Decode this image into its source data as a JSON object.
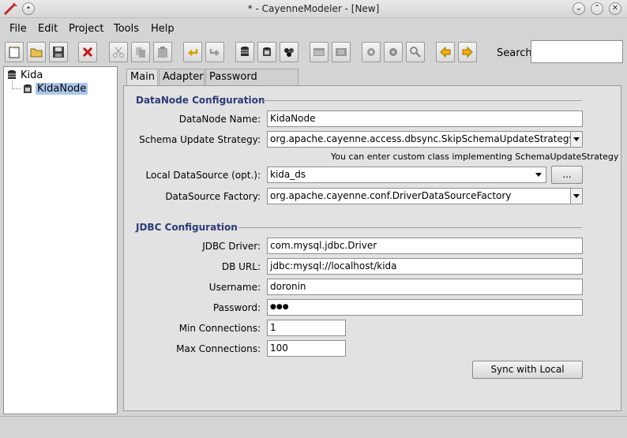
{
  "window": {
    "title": "* - CayenneModeler - [New]"
  },
  "menu": [
    {
      "label": "File"
    },
    {
      "label": "Edit"
    },
    {
      "label": "Project"
    },
    {
      "label": "Tools"
    },
    {
      "label": "Help"
    }
  ],
  "toolbar": {
    "search_label": "Search:",
    "search_value": ""
  },
  "tree": {
    "root": "Kida",
    "child": "KidaNode"
  },
  "tabs": [
    "Main",
    "Adapter",
    "Password Encoder"
  ],
  "datanode": {
    "section_title": "DataNode Configuration",
    "name_label": "DataNode Name:",
    "name_value": "KidaNode",
    "strategy_label": "Schema Update Strategy:",
    "strategy_value": "org.apache.cayenne.access.dbsync.SkipSchemaUpdateStrategy",
    "strategy_hint": "You can enter custom class implementing SchemaUpdateStrategy",
    "datasource_label": "Local DataSource (opt.):",
    "datasource_value": "kida_ds",
    "datasource_button": "...",
    "factory_label": "DataSource Factory:",
    "factory_value": "org.apache.cayenne.conf.DriverDataSourceFactory"
  },
  "jdbc": {
    "section_title": "JDBC Configuration",
    "driver_label": "JDBC Driver:",
    "driver_value": "com.mysql.jdbc.Driver",
    "url_label": "DB URL:",
    "url_value": "jdbc:mysql://localhost/kida",
    "username_label": "Username:",
    "username_value": "doronin",
    "password_label": "Password:",
    "password_value": "●●●",
    "min_label": "Min Connections:",
    "min_value": "1",
    "max_label": "Max Connections:",
    "max_value": "100",
    "sync_button": "Sync with Local"
  }
}
